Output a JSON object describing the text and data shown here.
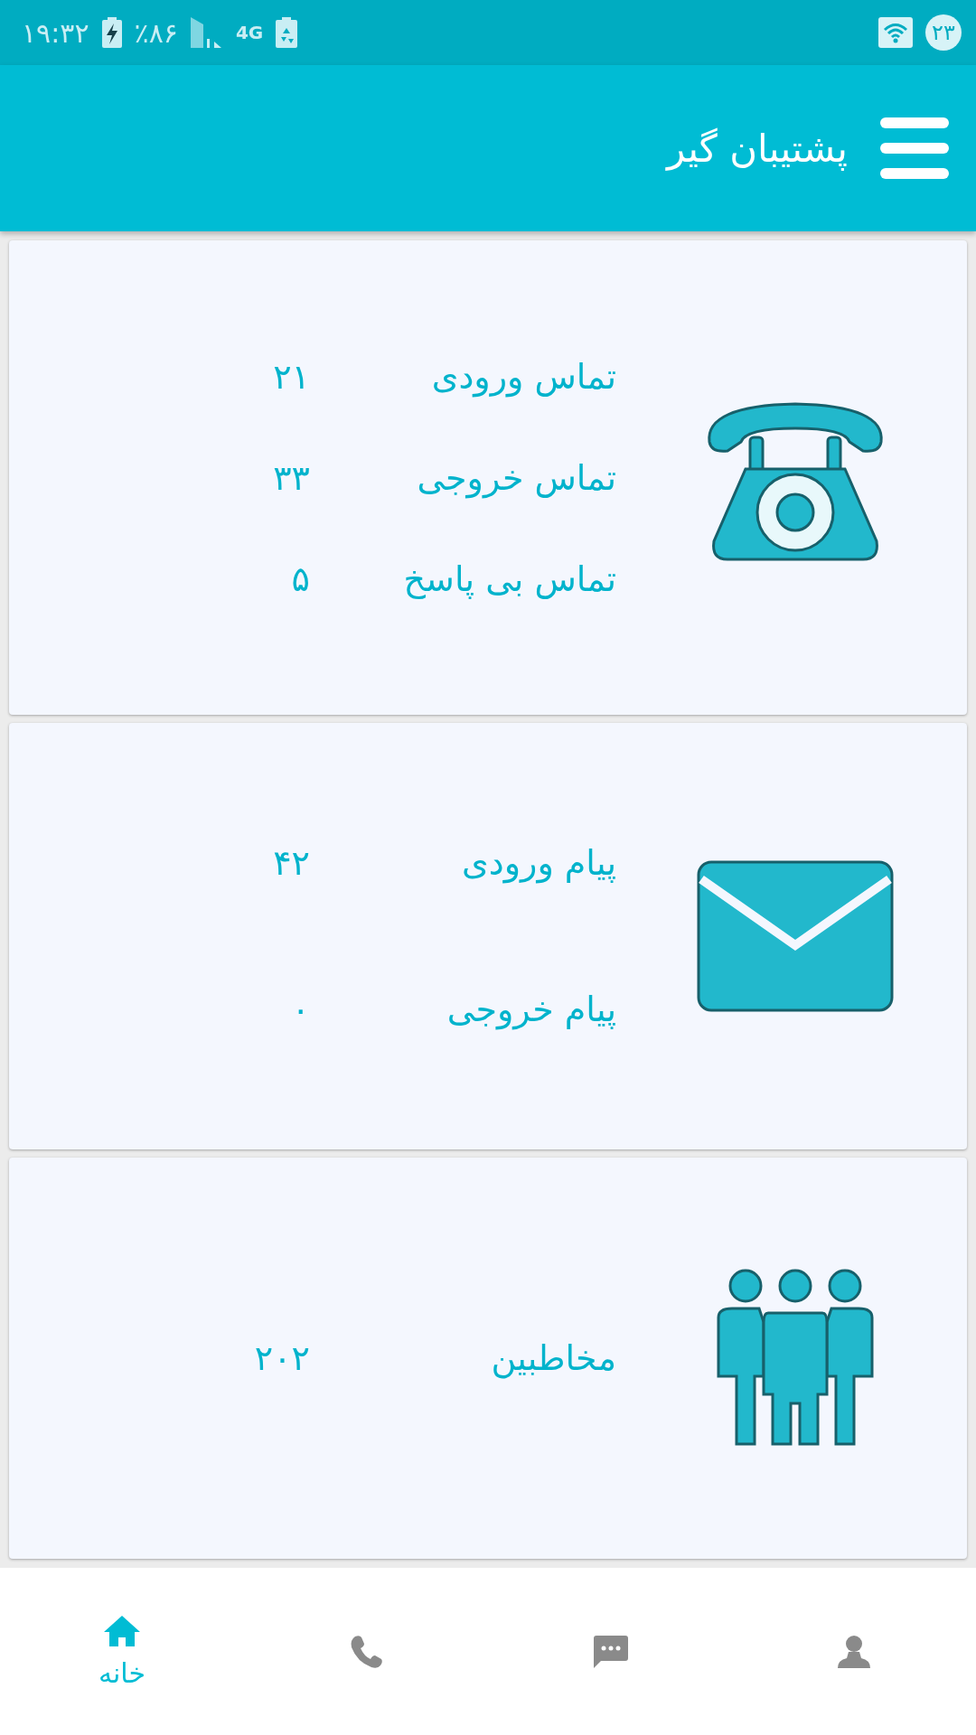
{
  "status_bar": {
    "time": "۱۹:۳۲",
    "battery": "٪۸۶",
    "network": "4G",
    "notification_count": "۲۳"
  },
  "app_bar": {
    "title": "پشتیبان گیر"
  },
  "cards": [
    {
      "kind": "phone",
      "rows": [
        {
          "label": "تماس ورودی",
          "value": "۲۱"
        },
        {
          "label": "تماس خروجی",
          "value": "۳۳"
        },
        {
          "label": "تماس بی پاسخ",
          "value": "۵"
        }
      ]
    },
    {
      "kind": "mail",
      "rows": [
        {
          "label": "پیام ورودی",
          "value": "۴۲"
        },
        {
          "label": "پیام خروجی",
          "value": "۰"
        }
      ]
    },
    {
      "kind": "people",
      "rows": [
        {
          "label": "مخاطبین",
          "value": "۲۰۲"
        }
      ]
    }
  ],
  "bottom_nav": [
    {
      "kind": "home",
      "label": "خانه",
      "selected": true
    },
    {
      "kind": "call",
      "selected": false
    },
    {
      "kind": "message",
      "selected": false
    },
    {
      "kind": "profile",
      "selected": false
    }
  ]
}
